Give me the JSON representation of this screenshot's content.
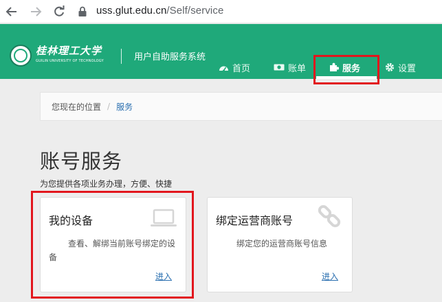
{
  "browser": {
    "url_host": "uss.glut.edu.cn",
    "url_path": "/Self/service"
  },
  "header": {
    "logo_cn": "桂林理工大学",
    "logo_en": "GUILIN UNIVERSITY OF TECHNOLOGY",
    "system_title": "用户自助服务系统",
    "nav": {
      "home": "首页",
      "bill": "账单",
      "service": "服务",
      "settings": "设置"
    }
  },
  "breadcrumb": {
    "current_label": "您现在的位置",
    "separator": "/",
    "page": "服务"
  },
  "section": {
    "title": "账号服务",
    "subtitle": "为您提供各项业务办理，方便、快捷"
  },
  "cards": [
    {
      "title": "我的设备",
      "icon": "laptop-icon",
      "description": "查看、解绑当前账号绑定的设备",
      "link": "进入"
    },
    {
      "title": "绑定运营商账号",
      "icon": "link-chain-icon",
      "description": "绑定您的运营商账号信息",
      "link": "进入"
    }
  ],
  "colors": {
    "header_green": "#1fa97a",
    "highlight_red": "#e2161d",
    "link_blue": "#2a6fb0"
  }
}
